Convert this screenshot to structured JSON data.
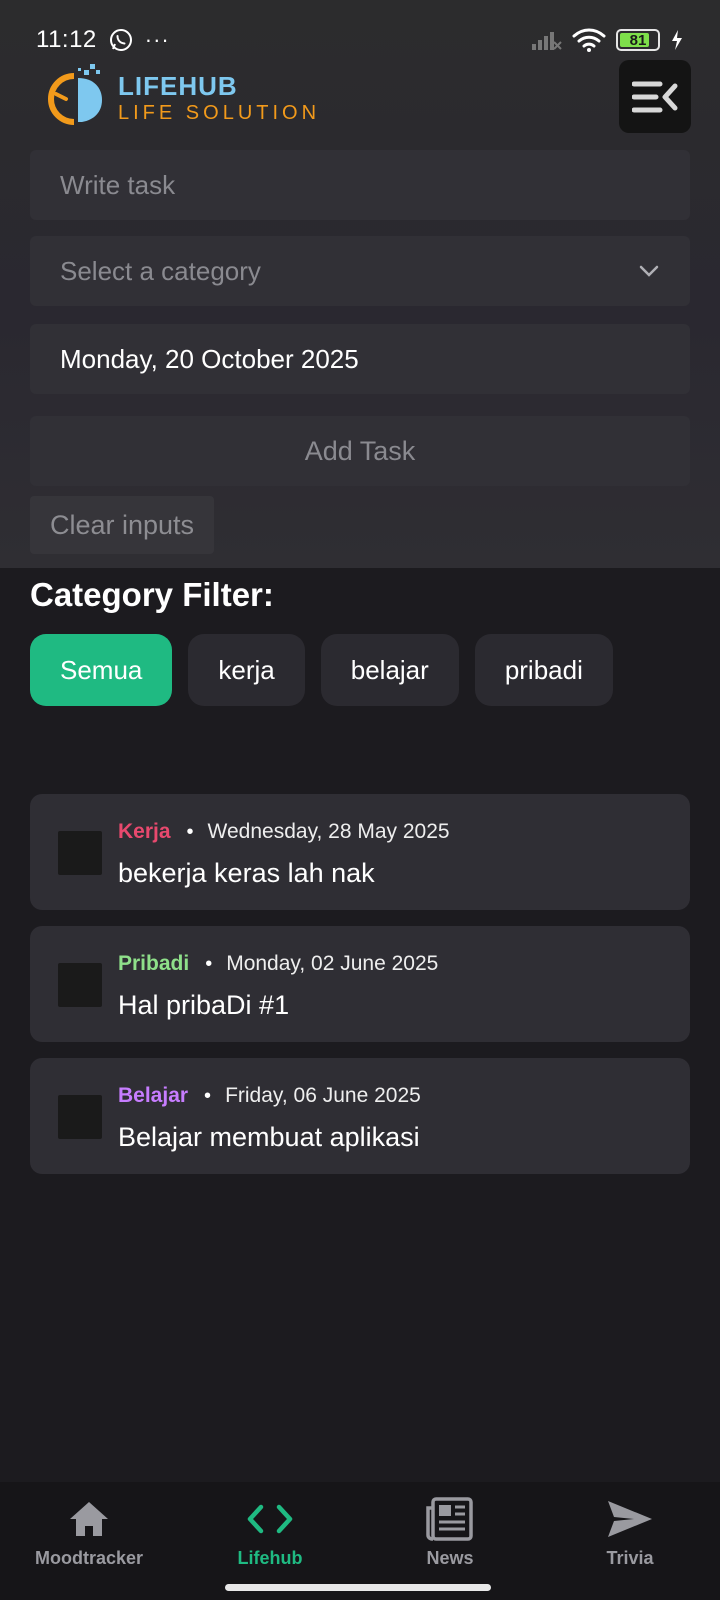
{
  "status_bar": {
    "time": "11:12",
    "more": "···",
    "battery": "81"
  },
  "header": {
    "logo_title": "LIFEHUB",
    "logo_subtitle": "LIFE SOLUTION"
  },
  "form": {
    "task_placeholder": "Write task",
    "category_placeholder": "Select a category",
    "date_value": "Monday, 20 October 2025",
    "add_label": "Add Task",
    "clear_label": "Clear inputs"
  },
  "filter": {
    "title": "Category Filter:",
    "chips": [
      {
        "label": "Semua",
        "active": true
      },
      {
        "label": "kerja",
        "active": false
      },
      {
        "label": "belajar",
        "active": false
      },
      {
        "label": "pribadi",
        "active": false
      }
    ]
  },
  "tasks": [
    {
      "category": "Kerja",
      "category_color": "#e8496e",
      "date": "Wednesday, 28 May 2025",
      "title": "bekerja keras lah nak",
      "checked": false
    },
    {
      "category": "Pribadi",
      "category_color": "#8fe08a",
      "date": "Monday, 02 June 2025",
      "title": "Hal pribaDi #1",
      "checked": false
    },
    {
      "category": "Belajar",
      "category_color": "#c77dff",
      "date": "Friday, 06 June 2025",
      "title": "Belajar membuat aplikasi",
      "checked": false
    }
  ],
  "nav": {
    "items": [
      {
        "label": "Moodtracker",
        "icon": "home-icon",
        "active": false
      },
      {
        "label": "Lifehub",
        "icon": "code-icon",
        "active": true
      },
      {
        "label": "News",
        "icon": "newspaper-icon",
        "active": false
      },
      {
        "label": "Trivia",
        "icon": "send-icon",
        "active": false
      }
    ]
  },
  "colors": {
    "accent": "#1fba82",
    "background": "#1c1b1f"
  }
}
